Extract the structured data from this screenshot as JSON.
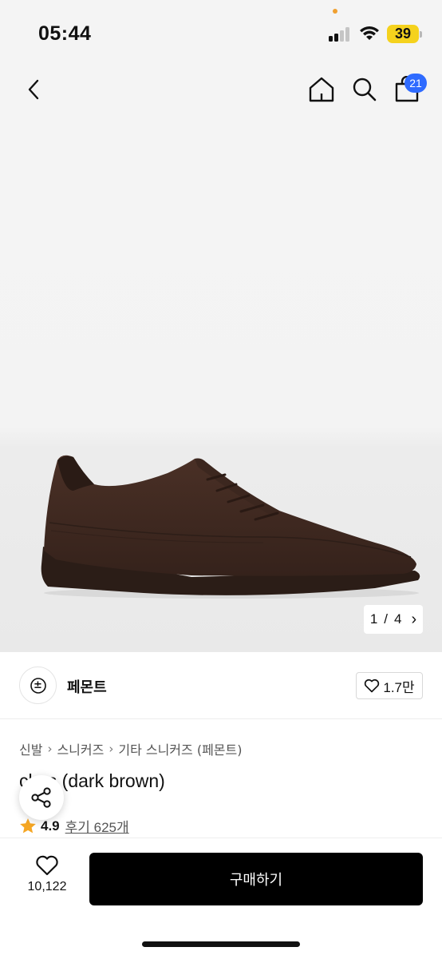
{
  "status_bar": {
    "time": "05:44",
    "battery": "39"
  },
  "nav": {
    "cart_count": "21",
    "icons": [
      "back-icon",
      "home-icon",
      "search-icon",
      "shopping-bag-icon"
    ]
  },
  "gallery": {
    "counter_current": "1",
    "counter_separator": "/",
    "counter_total": "4",
    "counter_arrow": "›"
  },
  "brand": {
    "name": "페몬트",
    "logo_glyph": "±",
    "likes": "1.7만"
  },
  "breadcrumb": {
    "items": [
      "신발",
      "스니커즈",
      "기타 스니커즈 (페몬트)"
    ],
    "separator": "›"
  },
  "product": {
    "title": "cl   s (dark brown)",
    "rating": "4.9",
    "reviews": "후기 625개"
  },
  "bottom_bar": {
    "wish_count": "10,122",
    "buy_label": "구매하기"
  },
  "colors": {
    "accent_badge": "#2f6bff",
    "star": "#f5a623",
    "buy_button": "#000000",
    "battery": "#f5d21d"
  }
}
